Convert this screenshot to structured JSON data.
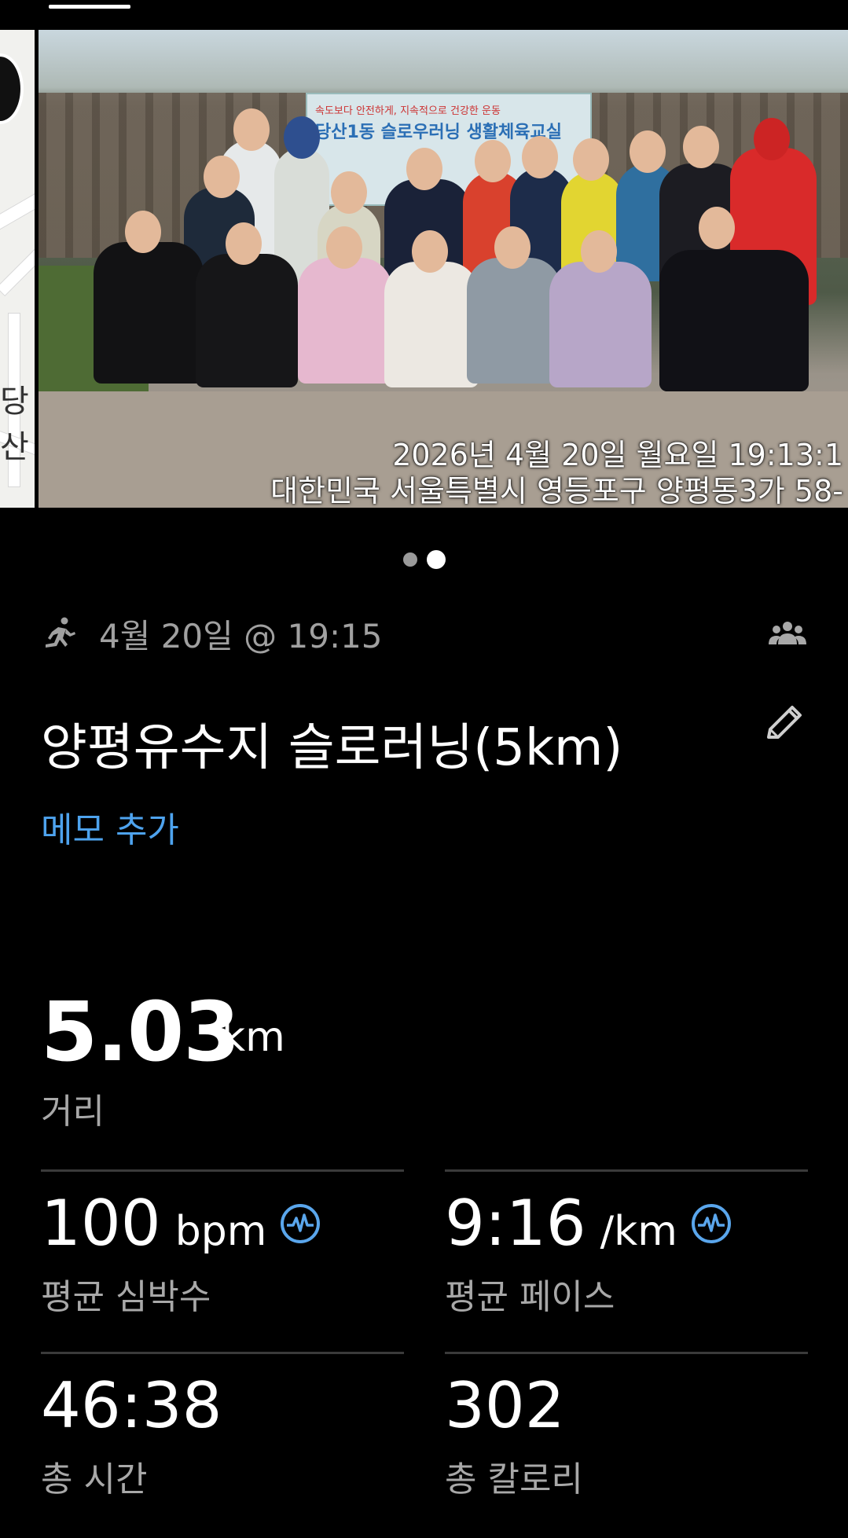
{
  "photo": {
    "banner_line1": "속도보다 안전하게, 지속적으로 건강한 운동",
    "banner_line2": "당산1동 슬로우러닝 생활체육교실",
    "caption_line1": "2026년 4월 20일 월요일 19:13:1",
    "caption_line2": "대한민국 서울특별시 영등포구 양평동3가 58-"
  },
  "map_thumb": {
    "label": "당산"
  },
  "carousel": {
    "page_count": 2,
    "active_index": 1
  },
  "activity": {
    "type_icon": "running-icon",
    "datetime": "4월 20일 @ 19:15",
    "group_icon": "group-icon",
    "title": "양평유수지 슬로러닝(5km)",
    "edit_icon": "pencil-icon",
    "memo_link": "메모 추가"
  },
  "distance": {
    "value": "5.03",
    "unit": "km",
    "label": "거리"
  },
  "stats": {
    "heart_rate": {
      "value": "100",
      "unit": "bpm",
      "label": "평균 심박수",
      "icon": "heart-rate-icon"
    },
    "pace": {
      "value": "9:16",
      "unit": "/km",
      "label": "평균 페이스",
      "icon": "heart-rate-icon"
    },
    "time": {
      "value": "46:38",
      "unit": "",
      "label": "총 시간"
    },
    "calories": {
      "value": "302",
      "unit": "",
      "label": "총 칼로리"
    }
  },
  "colors": {
    "accent_blue": "#4ea3ee",
    "background": "#000000",
    "secondary_text": "#a8a8a8"
  }
}
